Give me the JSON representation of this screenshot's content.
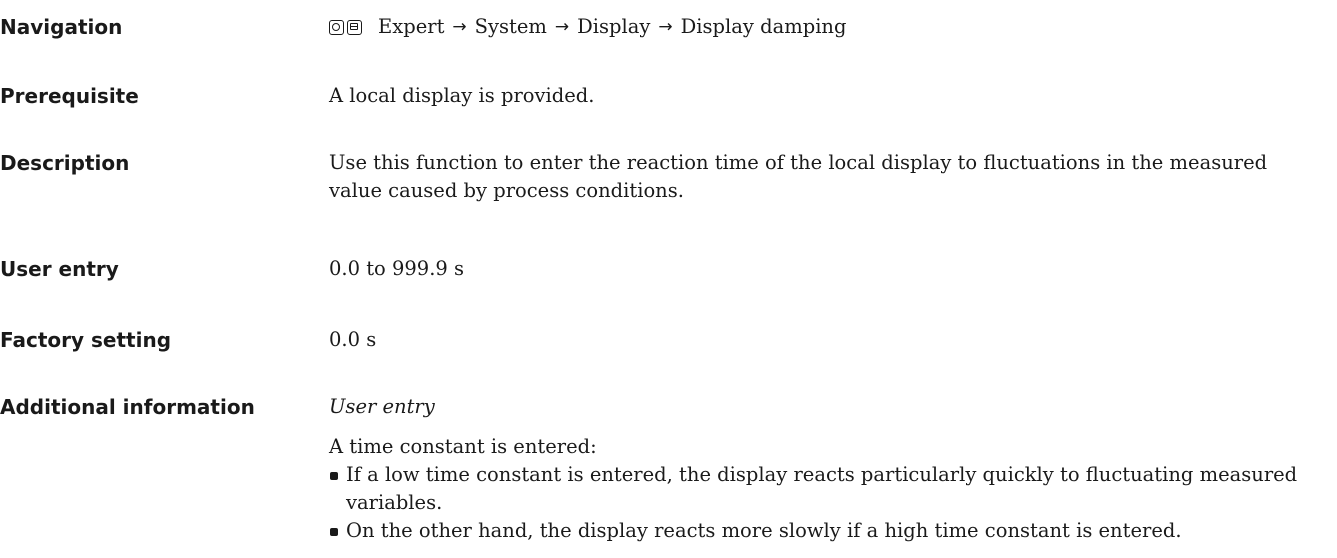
{
  "navigation": {
    "label": "Navigation",
    "icons": [
      "operating-keys-icon",
      "display-module-icon"
    ],
    "path": [
      "Expert",
      "System",
      "Display",
      "Display damping"
    ],
    "separator": "→"
  },
  "prerequisite": {
    "label": "Prerequisite",
    "text": "A local display is provided."
  },
  "description": {
    "label": "Description",
    "text": "Use this function to enter the reaction time of the local display to fluctuations in the measured value caused by process conditions."
  },
  "user_entry": {
    "label": "User entry",
    "text": "0.0 to 999.9 s"
  },
  "factory_setting": {
    "label": "Factory setting",
    "text": "0.0 s"
  },
  "additional_information": {
    "label": "Additional information",
    "subheading": "User entry",
    "intro": "A time constant is entered:",
    "bullets": [
      "If a low time constant is entered, the display reacts particularly quickly to fluctuating measured variables.",
      "On the other hand, the display reacts more slowly if a high time constant is entered."
    ]
  }
}
